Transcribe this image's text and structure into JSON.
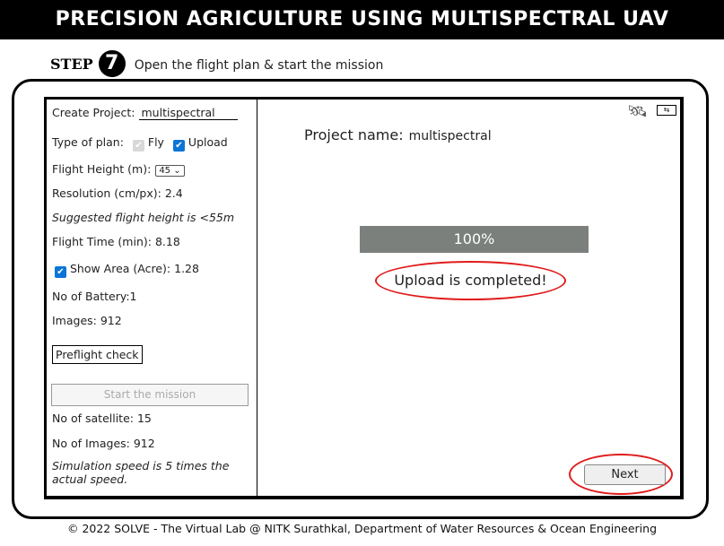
{
  "title": "PRECISION AGRICULTURE USING MULTISPECTRAL UAV",
  "step": {
    "label": "STEP",
    "number": "7",
    "text": "Open the flight plan & start the mission"
  },
  "left": {
    "create_project_label": "Create Project:",
    "project_value": "multispectral",
    "plan_label": "Type of plan:",
    "fly_label": "Fly",
    "upload_label": "Upload",
    "fly_checked": true,
    "upload_checked": true,
    "height_label": "Flight Height (m):",
    "height_value": "45",
    "resolution": "Resolution (cm/px): 2.4",
    "suggested": "Suggested flight height is <55m",
    "flight_time": "Flight Time (min): 8.18",
    "show_area": "Show Area (Acre): 1.28",
    "battery": "No of Battery:1",
    "images": "Images: 912",
    "preflight": "Preflight check",
    "start": "Start the mission",
    "satellite": "No of satellite: 15",
    "no_images": "No of Images: 912",
    "sim1": "Simulation speed is 5 times the",
    "sim2": "actual speed."
  },
  "right": {
    "project_label": "Project name:",
    "project_name": "multispectral",
    "progress_text": "100%",
    "progress": 100,
    "status": "Upload is completed!",
    "next": "Next",
    "icons": [
      "satellite-icon",
      "battery-icon"
    ]
  },
  "footer": "© 2022 SOLVE - The Virtual Lab @ NITK Surathkal, Department of Water Resources & Ocean Engineering",
  "colors": {
    "highlight": "#e01b1b",
    "progress": "#7b807d",
    "checkbox": "#0b75d6"
  }
}
